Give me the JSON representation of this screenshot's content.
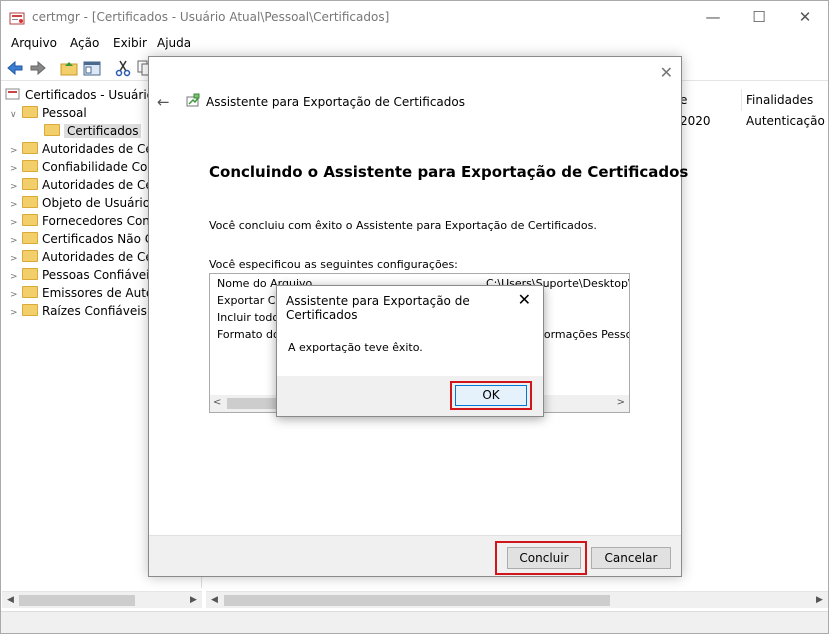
{
  "window": {
    "title": "certmgr - [Certificados - Usuário Atual\\Pessoal\\Certificados]",
    "minimize": "—",
    "maximize": "☐",
    "close": "✕"
  },
  "menu": [
    "Arquivo",
    "Ação",
    "Exibir",
    "Ajuda"
  ],
  "toolbar": {
    "back_icon": "arrow-left-icon",
    "forward_icon": "arrow-right-icon"
  },
  "tree": {
    "root": "Certificados - Usuário A",
    "pessoal": "Pessoal",
    "certificados": "Certificados",
    "items": [
      "Autoridades de Cer",
      "Confiabilidade Corp",
      "Autoridades de Cer",
      "Objeto de Usuário d",
      "Fornecedores Confi",
      "Certificados Não Co",
      "Autoridades de Cer",
      "Pessoas Confiáveis",
      "Emissores de Auten",
      "Raízes Confiáveis d"
    ]
  },
  "list": {
    "columns": [
      "e validade",
      "Finalidades"
    ],
    "row": [
      "2020",
      "Autenticação d"
    ]
  },
  "wizard": {
    "header": "Assistente para Exportação de Certificados",
    "heading": "Concluindo o Assistente para Exportação de Certificados",
    "text1": "Você concluiu com êxito o Assistente para Exportação de Certificados.",
    "text2": "Você especificou as seguintes configurações:",
    "settings": [
      {
        "name": "Nome do Arquivo",
        "value": "C:\\Users\\Suporte\\Desktop\\DC"
      },
      {
        "name": "Exportar Cha",
        "value": ""
      },
      {
        "name": "Incluir todos",
        "value": ""
      },
      {
        "name": "Formato do a",
        "value": "formações Pessoa"
      }
    ],
    "finish": "Concluir",
    "cancel": "Cancelar"
  },
  "messagebox": {
    "title": "Assistente para Exportação de Certificados",
    "text": "A exportação teve êxito.",
    "ok": "OK",
    "close": "✕"
  },
  "colors": {
    "highlight": "#d0161b",
    "ok_border": "#0078d7"
  }
}
